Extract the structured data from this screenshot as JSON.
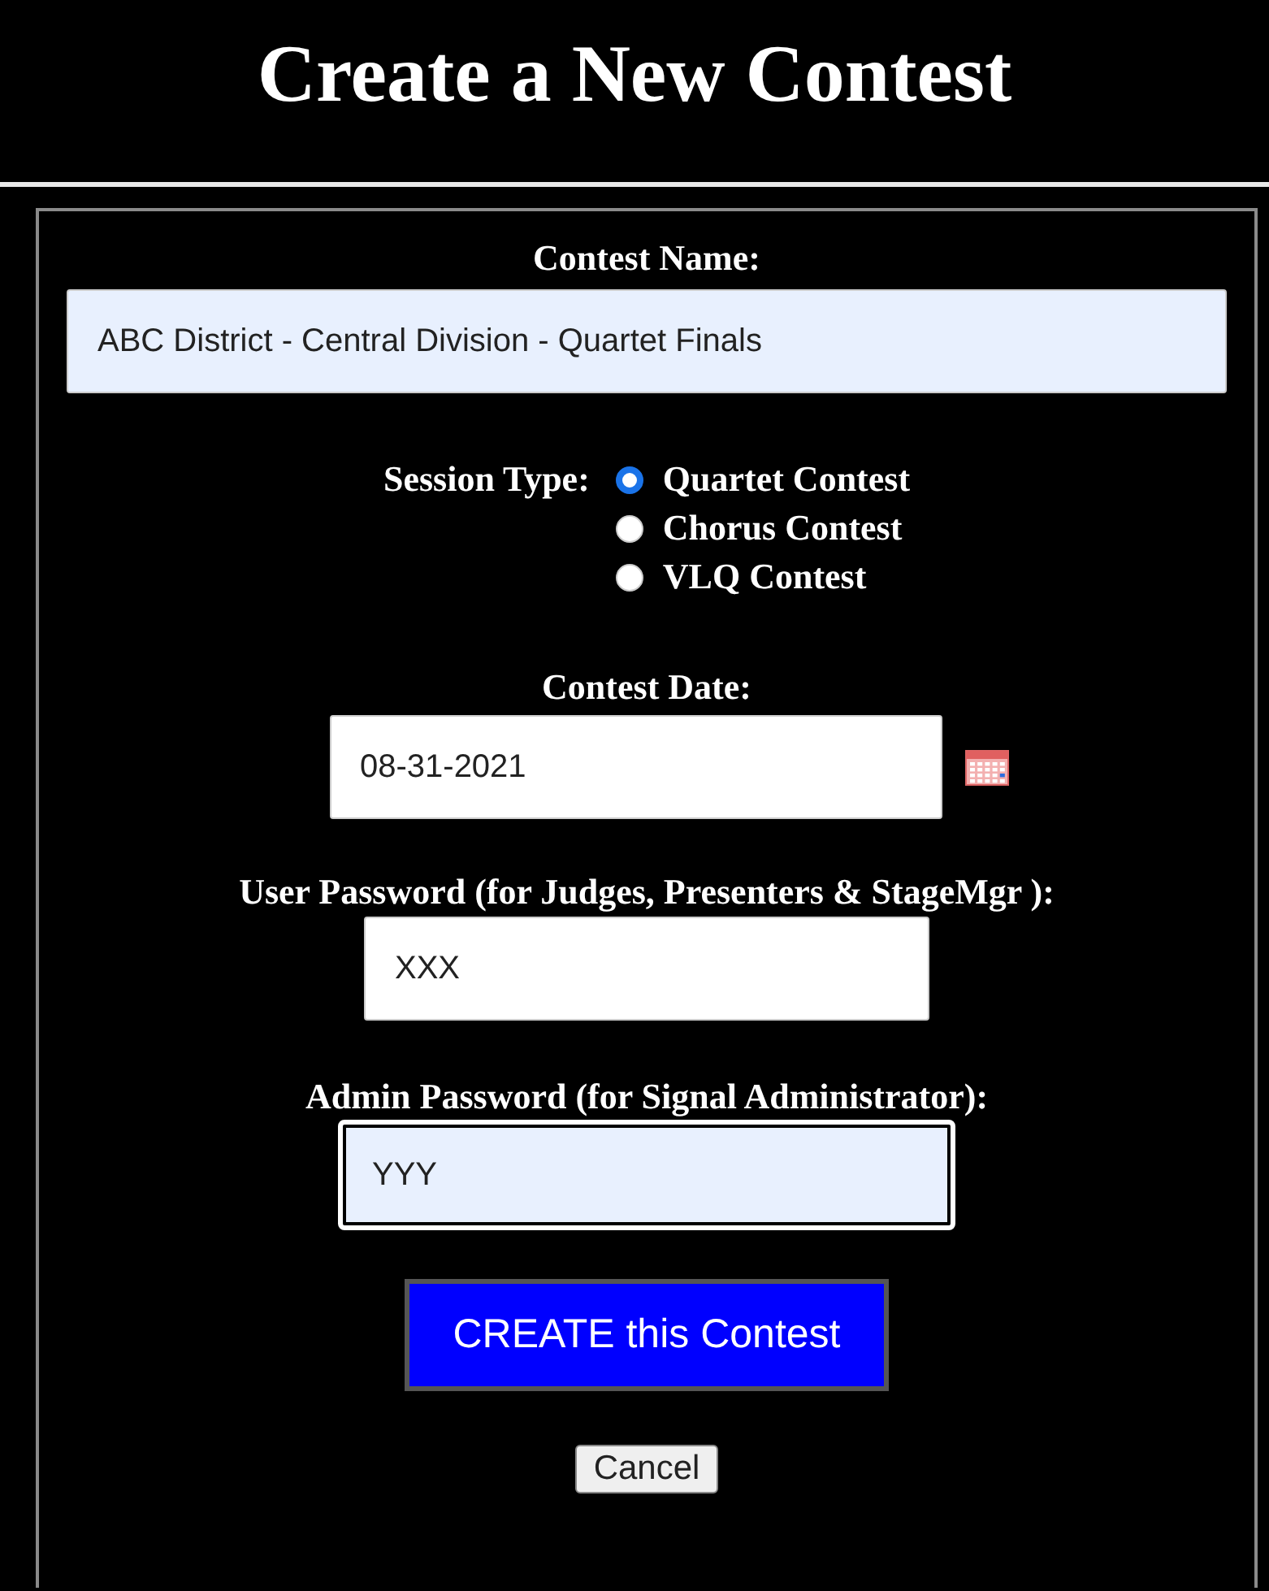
{
  "title": "Create a New Contest",
  "contest_name": {
    "label": "Contest Name:",
    "value": "ABC District - Central Division - Quartet Finals",
    "autofilled": true,
    "focused": false
  },
  "session_type": {
    "label": "Session Type:",
    "options": [
      {
        "label": "Quartet Contest",
        "selected": true
      },
      {
        "label": "Chorus Contest",
        "selected": false
      },
      {
        "label": "VLQ Contest",
        "selected": false
      }
    ]
  },
  "contest_date": {
    "label": "Contest Date:",
    "value": "08-31-2021",
    "autofilled": false,
    "focused": false
  },
  "user_password": {
    "label": "User Password (for Judges, Presenters & StageMgr ):",
    "value": "XXX",
    "autofilled": false,
    "focused": false
  },
  "admin_password": {
    "label": "Admin Password (for Signal Administrator):",
    "value": "YYY",
    "autofilled": true,
    "focused": true
  },
  "buttons": [
    {
      "label": "CREATE this Contest",
      "kind": "primary"
    },
    {
      "label": "Cancel",
      "kind": "secondary"
    }
  ]
}
